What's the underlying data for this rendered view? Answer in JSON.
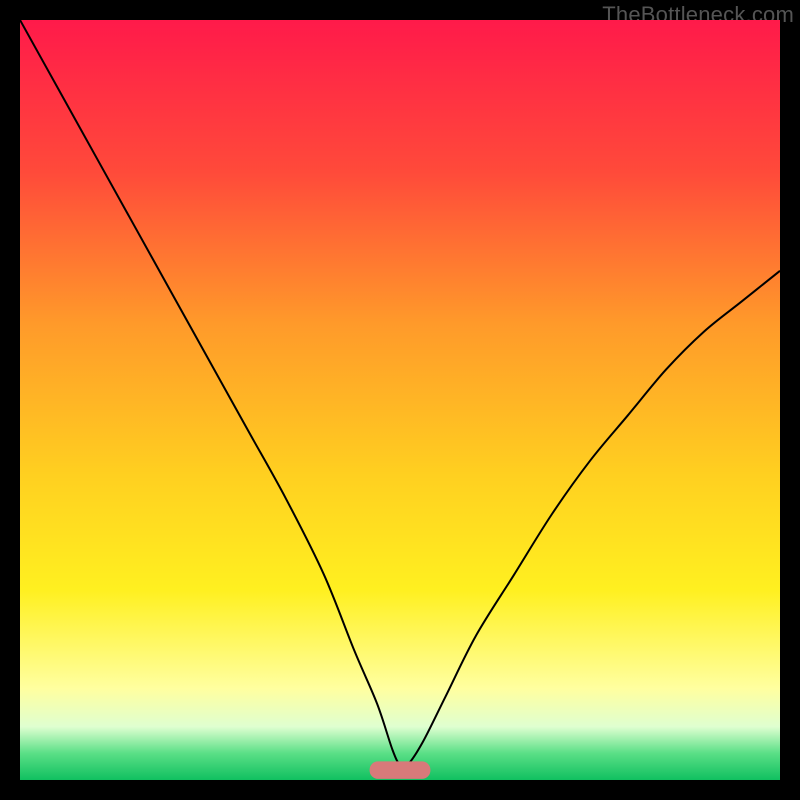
{
  "watermark": "TheBottleneck.com",
  "chart_data": {
    "type": "line",
    "title": "",
    "xlabel": "",
    "ylabel": "",
    "xlim": [
      0,
      100
    ],
    "ylim": [
      0,
      100
    ],
    "grid": false,
    "legend": false,
    "background_gradient": {
      "stops": [
        {
          "offset": 0.0,
          "color": "#ff1a4a"
        },
        {
          "offset": 0.2,
          "color": "#ff4a3a"
        },
        {
          "offset": 0.4,
          "color": "#ff9a2a"
        },
        {
          "offset": 0.6,
          "color": "#ffd020"
        },
        {
          "offset": 0.75,
          "color": "#fff020"
        },
        {
          "offset": 0.88,
          "color": "#ffffa0"
        },
        {
          "offset": 0.93,
          "color": "#dfffd0"
        },
        {
          "offset": 0.965,
          "color": "#5adf86"
        },
        {
          "offset": 1.0,
          "color": "#10c060"
        }
      ]
    },
    "series": [
      {
        "name": "bottleneck-curve",
        "stroke": "#000000",
        "stroke_width": 2,
        "x": [
          0,
          5,
          10,
          15,
          20,
          25,
          30,
          35,
          40,
          44,
          47,
          49,
          50,
          51,
          53,
          56,
          60,
          65,
          70,
          75,
          80,
          85,
          90,
          95,
          100
        ],
        "y": [
          100,
          91,
          82,
          73,
          64,
          55,
          46,
          37,
          27,
          17,
          10,
          4,
          2,
          2,
          5,
          11,
          19,
          27,
          35,
          42,
          48,
          54,
          59,
          63,
          67
        ]
      }
    ],
    "marker": {
      "name": "optimal-range",
      "shape": "rounded-rect",
      "fill": "#d87a7a",
      "x_center": 50,
      "y_center": 1.3,
      "width": 8,
      "height": 2.3,
      "rx": 1.1
    }
  }
}
